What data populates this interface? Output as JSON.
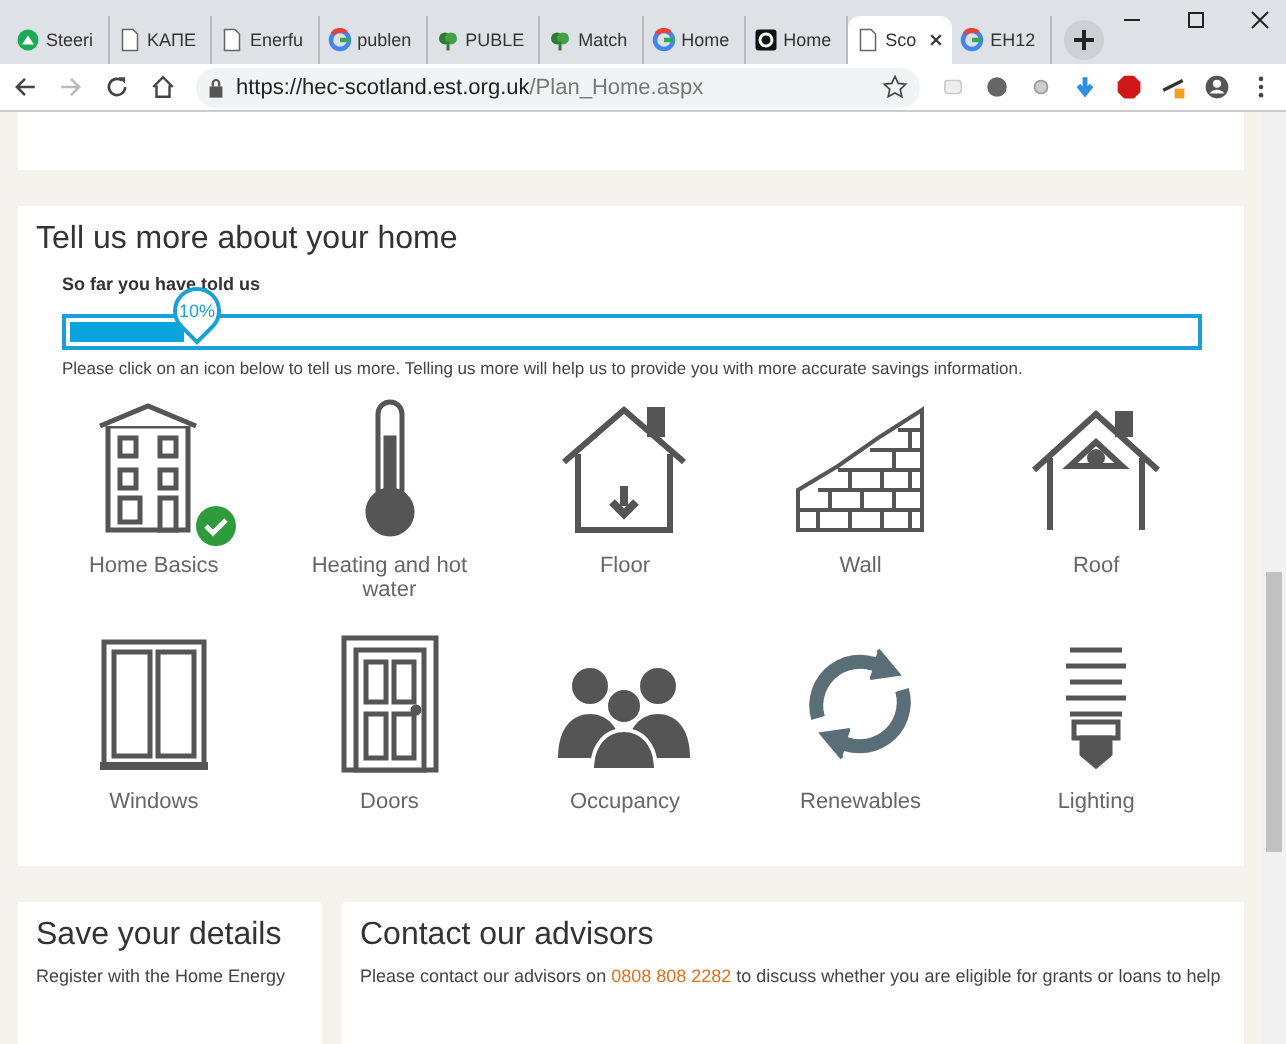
{
  "tabs": [
    {
      "label": "Steeri",
      "selected": false
    },
    {
      "label": "KAΠE",
      "selected": false
    },
    {
      "label": "Enerfu",
      "selected": false
    },
    {
      "label": "publen",
      "selected": false
    },
    {
      "label": "PUBLE",
      "selected": false
    },
    {
      "label": "Match",
      "selected": false
    },
    {
      "label": "Home",
      "selected": false
    },
    {
      "label": "Home",
      "selected": false
    },
    {
      "label": "Sco",
      "selected": true
    },
    {
      "label": "EH12",
      "selected": false
    }
  ],
  "address": {
    "host": "https://hec-scotland.est.org.uk",
    "path": "/Plan_Home.aspx"
  },
  "section": {
    "title": "Tell us more about your home",
    "progress_label": "So far you have told us",
    "level": 0.1,
    "reading": "10%",
    "hint": "Please click on an icon below to tell us more. Telling us more will help us to provide you with more accurate savings information."
  },
  "tiles": [
    {
      "kind": "house",
      "label": "Home Basics",
      "completed": true
    },
    {
      "kind": "thermometer",
      "label": "Heating and hot water",
      "completed": false
    },
    {
      "kind": "floor",
      "label": "Floor",
      "completed": false
    },
    {
      "kind": "wall",
      "label": "Wall",
      "completed": false
    },
    {
      "kind": "roof",
      "label": "Roof",
      "completed": false
    },
    {
      "kind": "windows",
      "label": "Windows",
      "completed": false
    },
    {
      "kind": "doors",
      "label": "Doors",
      "completed": false
    },
    {
      "kind": "people",
      "label": "Occupancy",
      "completed": false
    },
    {
      "kind": "arrows",
      "label": "Renewables",
      "completed": false
    },
    {
      "kind": "bulb",
      "label": "Lighting",
      "completed": false
    }
  ],
  "save": {
    "title": "Save your details",
    "text": "Register with the Home Energy"
  },
  "contact": {
    "title": "Contact our advisors",
    "before": "Please contact our advisors on",
    "phone": "0808 808 2282",
    "after": "to discuss whether you are eligible for grants or loans to help"
  }
}
